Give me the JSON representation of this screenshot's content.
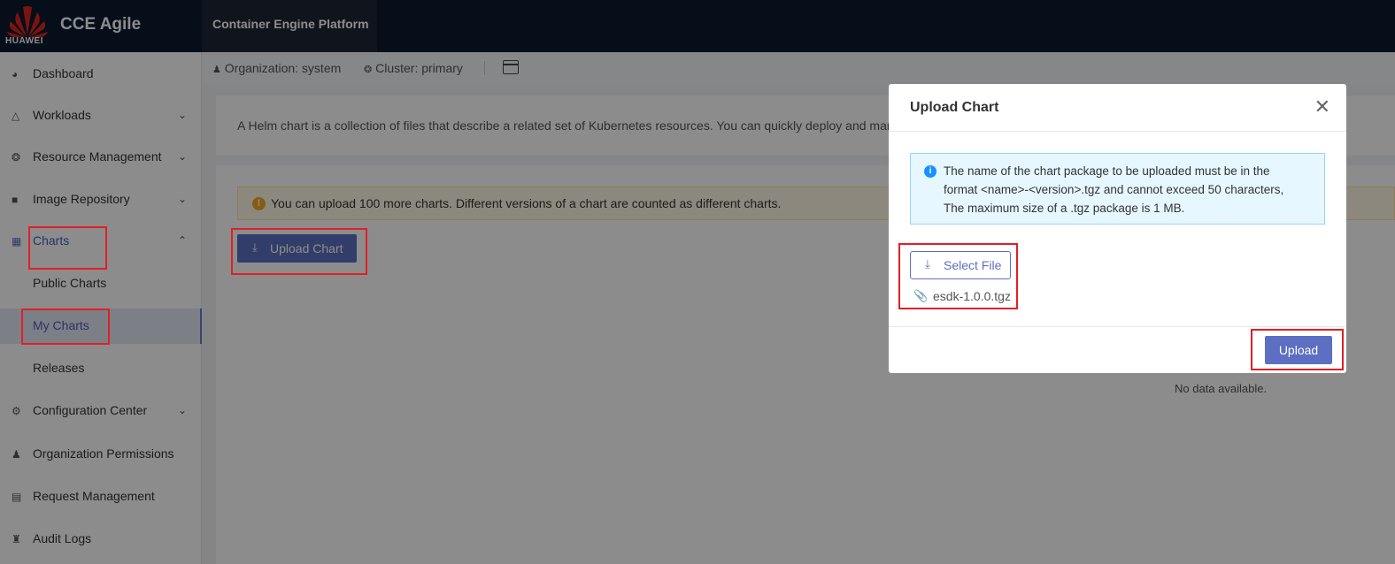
{
  "brand": {
    "logo_text": "HUAWEI",
    "app_title": "CCE Agile"
  },
  "platform_tab": "Container Engine Platform",
  "sidebar": {
    "items": [
      {
        "label": "Dashboard",
        "icon": "dashboard-icon"
      },
      {
        "label": "Workloads",
        "icon": "workloads-icon"
      },
      {
        "label": "Resource Management",
        "icon": "resource-icon"
      },
      {
        "label": "Image Repository",
        "icon": "image-repo-icon"
      },
      {
        "label": "Charts",
        "icon": "charts-icon"
      },
      {
        "label": "Public Charts"
      },
      {
        "label": "My Charts"
      },
      {
        "label": "Releases"
      },
      {
        "label": "Configuration Center",
        "icon": "config-icon"
      },
      {
        "label": "Organization Permissions",
        "icon": "org-permissions-icon"
      },
      {
        "label": "Request Management",
        "icon": "request-icon"
      },
      {
        "label": "Audit Logs",
        "icon": "audit-icon"
      }
    ]
  },
  "subheader": {
    "organization": "Organization: system",
    "cluster": "Cluster: primary"
  },
  "main": {
    "description": "A Helm chart is a collection of files that describe a related set of Kubernetes resources. You can quickly deploy and mana",
    "notice": "You can upload 100 more charts. Different versions of a chart are counted as different charts.",
    "upload_chart_label": "Upload Chart",
    "no_data": "No data available."
  },
  "modal": {
    "title": "Upload Chart",
    "info_line1": "The name of the chart package to be uploaded must be in the",
    "info_line2": "format <name>-<version>.tgz and cannot exceed 50 characters,",
    "info_line3": "The maximum size of a .tgz package is 1 MB.",
    "select_file_label": "Select File",
    "file_name": "esdk-1.0.0.tgz",
    "upload_label": "Upload"
  },
  "colors": {
    "primary": "#5d6fc2",
    "topbar": "#0b1a30",
    "highlight": "#e21f26"
  }
}
